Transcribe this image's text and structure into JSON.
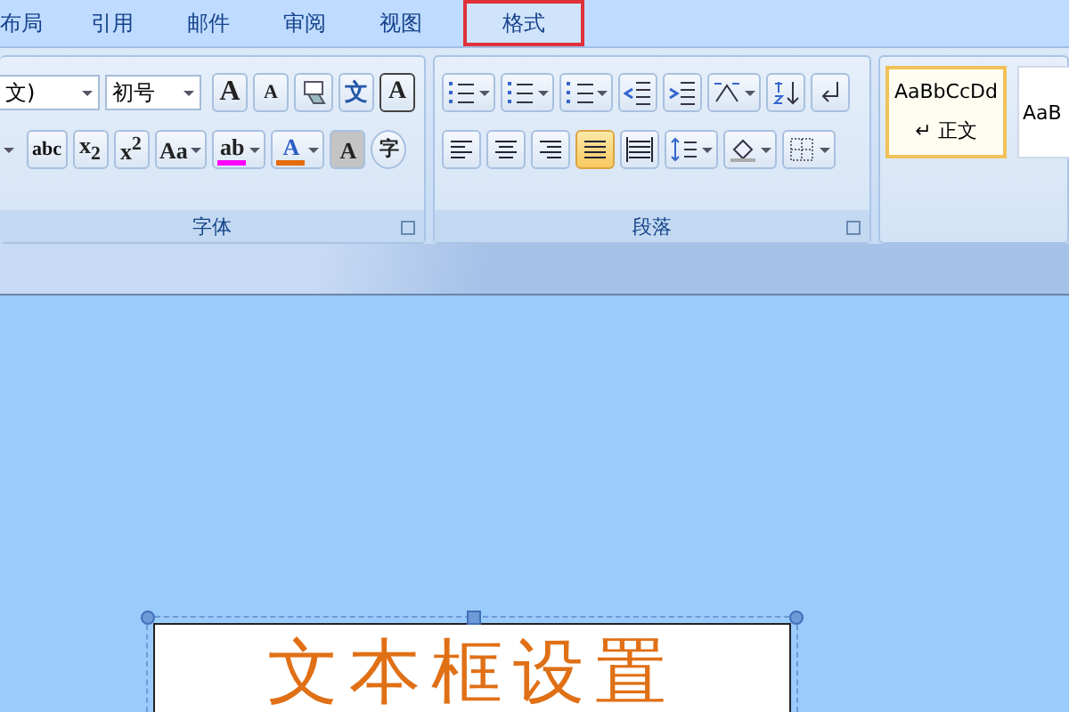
{
  "tabs": [
    {
      "label": "布局",
      "selected": false
    },
    {
      "label": "引用",
      "selected": false
    },
    {
      "label": "邮件",
      "selected": false
    },
    {
      "label": "审阅",
      "selected": false
    },
    {
      "label": "视图",
      "selected": false
    },
    {
      "label": "格式",
      "selected": true
    }
  ],
  "font_group": {
    "label": "字体",
    "font_field": {
      "value": "文)"
    },
    "size_field": {
      "value": "初号"
    },
    "row1": [
      {
        "kind": "grow",
        "text": "A"
      },
      {
        "kind": "shrink",
        "text": "A"
      },
      {
        "kind": "clear"
      },
      {
        "kind": "phonetic",
        "text": "文"
      },
      {
        "kind": "border",
        "text": "A"
      }
    ],
    "row2": [
      {
        "kind": "strike",
        "text": "abc"
      },
      {
        "kind": "sub",
        "text": "x$_{2}$"
      },
      {
        "kind": "sup",
        "text": "x$^{2}$"
      },
      {
        "kind": "case",
        "text": "Aa"
      },
      {
        "kind": "highlight",
        "text": "ab",
        "color": "#ff00ff"
      },
      {
        "kind": "color",
        "text": "A",
        "color": "#e46c0a"
      },
      {
        "kind": "shade",
        "text": "A"
      },
      {
        "kind": "enclose",
        "text": "字"
      }
    ]
  },
  "paragraph_group": {
    "label": "段落",
    "row1": [
      {
        "kind": "bullets"
      },
      {
        "kind": "numbering"
      },
      {
        "kind": "multilevel"
      },
      {
        "kind": "outdent"
      },
      {
        "kind": "indent"
      },
      {
        "kind": "asian-layout"
      },
      {
        "kind": "sort"
      },
      {
        "kind": "marks"
      }
    ],
    "align_buttons": [
      {
        "kind": "left",
        "selected": false
      },
      {
        "kind": "center",
        "selected": false
      },
      {
        "kind": "right",
        "selected": false
      },
      {
        "kind": "justify",
        "selected": true
      },
      {
        "kind": "distributed",
        "selected": false
      }
    ],
    "row2_more": [
      {
        "kind": "spacing"
      },
      {
        "kind": "shading"
      },
      {
        "kind": "borders"
      }
    ]
  },
  "styles": [
    {
      "sample": "AaBbCcDd",
      "name": "↵ 正文",
      "selected": true
    },
    {
      "sample": "AaB",
      "selected": false
    }
  ],
  "text_box": {
    "text": "文本框设置"
  }
}
